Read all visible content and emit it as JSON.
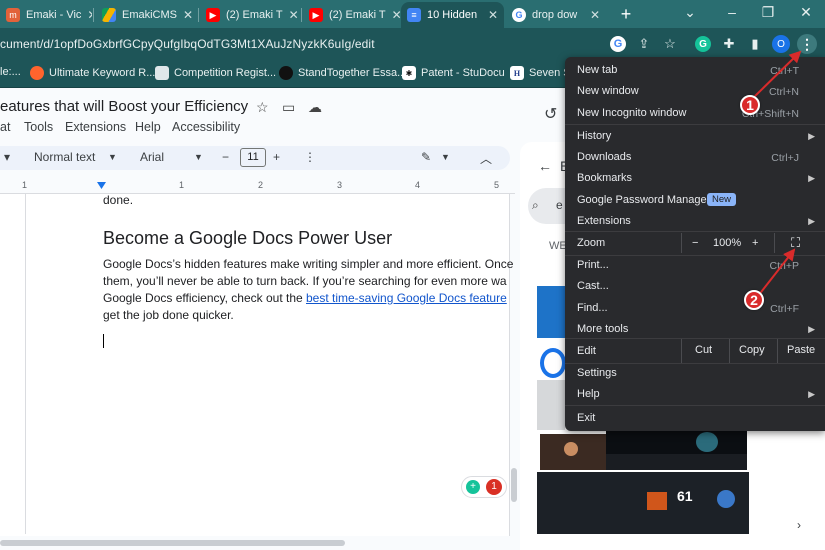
{
  "tabs": [
    {
      "title": "Emaki - Vic",
      "favicon": "emaki-icon",
      "active": false
    },
    {
      "title": "EmakiCMS",
      "favicon": "drive-icon",
      "active": false
    },
    {
      "title": "(2) Emaki T",
      "favicon": "youtube-icon",
      "active": false
    },
    {
      "title": "(2) Emaki T",
      "favicon": "youtube-icon",
      "active": false
    },
    {
      "title": "10 Hidden",
      "favicon": "docs-icon",
      "active": true
    },
    {
      "title": "drop dow",
      "favicon": "google-icon",
      "active": false
    }
  ],
  "tab_close": "✕",
  "new_tab": "+",
  "window_controls": {
    "minimize": "⌄",
    "min": "–",
    "restore": "❐",
    "close": "✕"
  },
  "address_bar": {
    "url": "cument/d/1opfDoGxbrfGCpyQufgIbqOdTG3Mt1XAuJzNyzkK6uIg/edit",
    "profile_initial": "O",
    "extension_letter": "G"
  },
  "bookmarks": [
    {
      "label": "le:...",
      "icon": "page-icon"
    },
    {
      "label": "Ultimate Keyword R...",
      "icon": "semrush-icon"
    },
    {
      "label": "Competition Regist...",
      "icon": "doc-icon"
    },
    {
      "label": "StandTogether Essa...",
      "icon": "dark-circle-icon"
    },
    {
      "label": "Patent - StuDocu",
      "icon": "studocu-icon"
    },
    {
      "label": "Seven St",
      "icon": "h-icon"
    }
  ],
  "doc": {
    "title": "eatures that will Boost your Efficiency",
    "menus": [
      "at",
      "Tools",
      "Extensions",
      "Help",
      "Accessibility"
    ],
    "toolbar": {
      "style": "Normal text",
      "font": "Arial",
      "size": "11",
      "minus": "−",
      "plus": "+"
    },
    "ruler_numbers": [
      "1",
      "1",
      "2",
      "3",
      "4",
      "5"
    ],
    "prev_line": "done.",
    "heading": "Become a Google Docs Power User",
    "para_line1": "Google Docs’s hidden features make writing simpler and more efficient. Once",
    "para_line2": "them, you’ll never be able to turn back. If you’re searching for even more wa",
    "para_line3_pre": "Google Docs efficiency, check out the ",
    "para_line3_link": "best time-saving Google Docs feature",
    "para_line4": "get the job done quicker.",
    "badge_count": "1"
  },
  "side_panel": {
    "search_char": "e",
    "tab_label": "WE"
  },
  "chrome_menu": {
    "items": [
      {
        "label": "New tab",
        "shortcut": "Ctrl+T"
      },
      {
        "label": "New window",
        "shortcut": "Ctrl+N"
      },
      {
        "label": "New Incognito window",
        "shortcut": "Ctrl+Shift+N"
      },
      {
        "label": "History",
        "shortcut": ""
      },
      {
        "label": "Downloads",
        "shortcut": "Ctrl+J"
      },
      {
        "label": "Bookmarks",
        "shortcut": ""
      },
      {
        "label": "Google Password Manager",
        "shortcut": ""
      },
      {
        "label": "Extensions",
        "shortcut": ""
      },
      {
        "label": "Zoom",
        "shortcut": ""
      },
      {
        "label": "Print...",
        "shortcut": "Ctrl+P"
      },
      {
        "label": "Cast...",
        "shortcut": ""
      },
      {
        "label": "Find...",
        "shortcut": "Ctrl+F"
      },
      {
        "label": "More tools",
        "shortcut": ""
      },
      {
        "label": "Edit",
        "shortcut": ""
      },
      {
        "label": "Settings",
        "shortcut": ""
      },
      {
        "label": "Help",
        "shortcut": ""
      },
      {
        "label": "Exit",
        "shortcut": ""
      }
    ],
    "new_badge": "New",
    "zoom": {
      "minus": "−",
      "value": "100%",
      "plus": "+"
    },
    "edit": {
      "cut": "Cut",
      "copy": "Copy",
      "paste": "Paste"
    }
  },
  "annotations": [
    {
      "number": "1",
      "color": "#d92b2b"
    },
    {
      "number": "2",
      "color": "#d92b2b"
    }
  ],
  "colors": {
    "tab_strip": "#2a6e71",
    "toolbar": "#1e5558",
    "menu_bg": "#292a2d",
    "annotation_red": "#d92b2b",
    "link_blue": "#1155cc"
  }
}
